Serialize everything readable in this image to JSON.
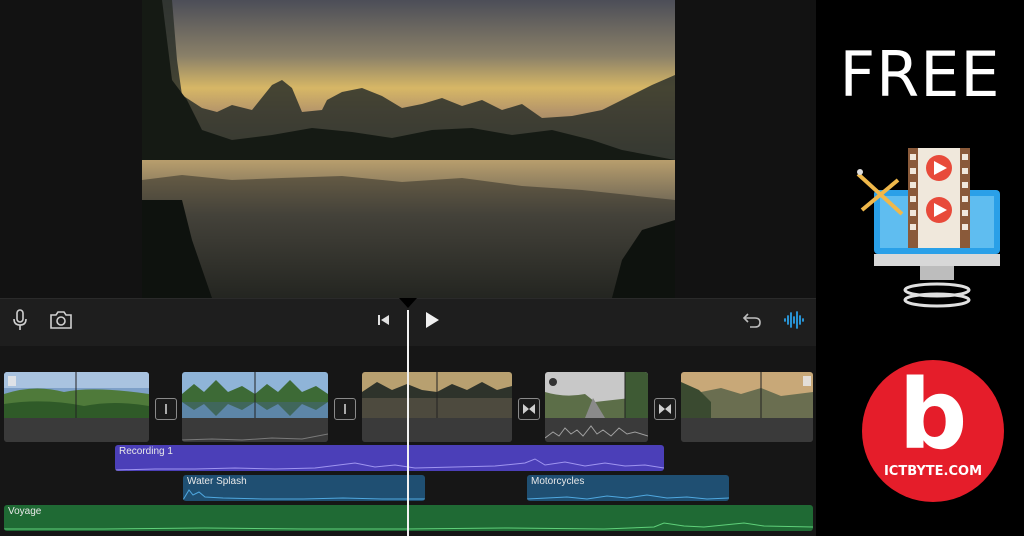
{
  "app": {
    "toolbar": {
      "icons": [
        "microphone-icon",
        "camera-icon",
        "skip-to-start-icon",
        "play-icon",
        "undo-icon",
        "audio-waveform-icon"
      ]
    },
    "timeline": {
      "audio_tracks": [
        {
          "label": "Recording 1",
          "color": "#4b3fb8"
        },
        {
          "label": "Water Splash",
          "color": "#1f4f72"
        },
        {
          "label": "Motorcycles",
          "color": "#1f4f72"
        },
        {
          "label": "Voyage",
          "color": "#1f6a34"
        }
      ],
      "accent_color": "#2aa0e8"
    }
  },
  "branding": {
    "headline": "FREE",
    "logo_letter": "b",
    "logo_site": "ICTBYTE.COM",
    "logo_color": "#e51d2a"
  }
}
